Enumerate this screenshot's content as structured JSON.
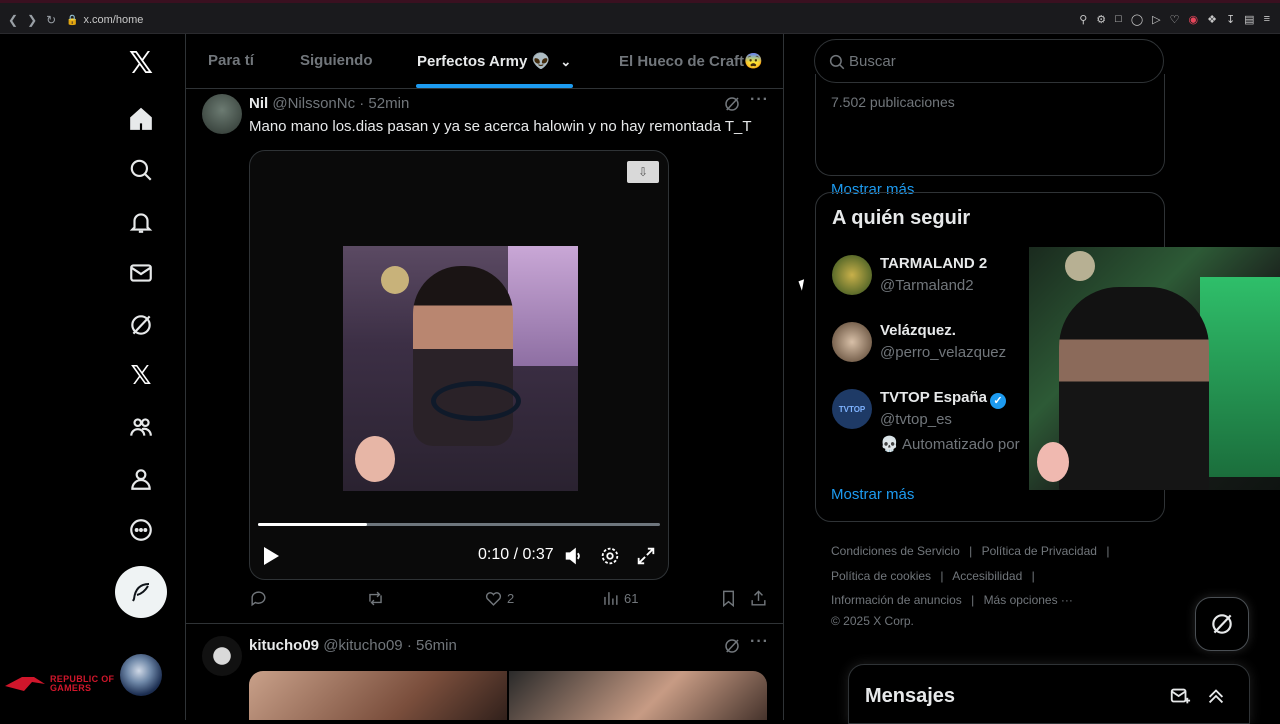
{
  "browser": {
    "url": "x.com/home"
  },
  "tabs": [
    {
      "label": "Para tí"
    },
    {
      "label": "Siguiendo"
    },
    {
      "label": "Perfectos Army 👽"
    },
    {
      "label": "El Hueco de Craft😨"
    }
  ],
  "tweet1": {
    "name": "Nil",
    "handle": "@NilssonNc",
    "time": "· 52min",
    "text": "Mano mano los.dias pasan y ya se acerca halowin y no hay remontada T_T",
    "video": {
      "time": "0:10 / 0:37",
      "progress": 0.27
    },
    "likes": "2",
    "views": "61"
  },
  "tweet2": {
    "name": "kitucho09",
    "handle": "@kitucho09",
    "time": "· 56min"
  },
  "search": {
    "placeholder": "Buscar"
  },
  "trends": {
    "publications": "7.502 publicaciones",
    "show_more": "Mostrar más"
  },
  "who_to_follow": {
    "title": "A quién seguir",
    "accounts": [
      {
        "name": "TARMALAND 2",
        "handle": "@Tarmaland2"
      },
      {
        "name": "Velázquez.",
        "handle": "@perro_velazquez"
      },
      {
        "name": "TVTOP España",
        "handle": "@tvtop_es",
        "extra": "💀 Automatizado por",
        "avatar_text": "TVTOP"
      }
    ],
    "show_more": "Mostrar más"
  },
  "footer": {
    "links_row1": [
      "Condiciones de Servicio",
      "|",
      "Política de Privacidad",
      "|"
    ],
    "links_row2": [
      "Política de cookies",
      "|",
      "Accesibilidad",
      "|"
    ],
    "links_row3": [
      "Información de anuncios",
      "|",
      "Más opciones ···"
    ],
    "copyright": "© 2025 X Corp."
  },
  "messages": {
    "label": "Mensajes"
  },
  "rog": {
    "line1": "REPUBLIC OF",
    "line2": "GAMERS"
  },
  "colors": {
    "accent": "#1d9bf0",
    "bg": "#000000",
    "border": "#2f3336",
    "muted": "#71767b"
  }
}
